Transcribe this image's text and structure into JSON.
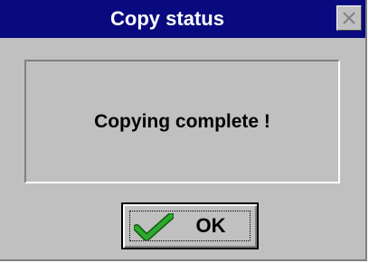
{
  "dialog": {
    "title": "Copy status",
    "message": "Copying complete !",
    "ok_label": "OK"
  },
  "icons": {
    "close": "close-icon",
    "confirm": "checkmark-icon"
  },
  "colors": {
    "title_bar": "#0a0a80",
    "title_text": "#ffffff",
    "dialog_face": "#c0c0c0",
    "checkmark": "#1e8a1e"
  }
}
